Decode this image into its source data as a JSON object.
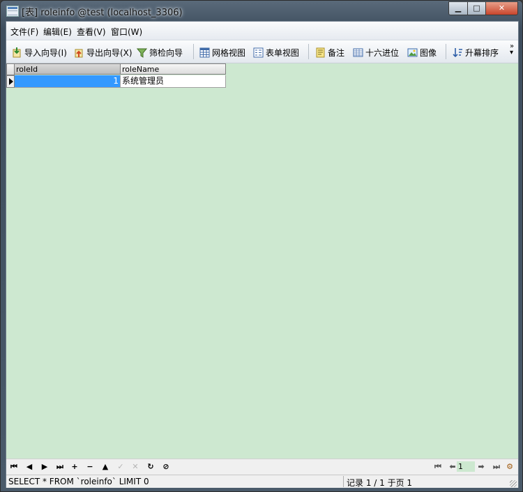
{
  "window": {
    "title": "[表] roleinfo @test (localhost_3306)",
    "minimize_label": "▁",
    "maximize_label": "□",
    "close_label": "✕"
  },
  "menu": [
    {
      "label": "文件(F)"
    },
    {
      "label": "编辑(E)"
    },
    {
      "label": "查看(V)"
    },
    {
      "label": "窗口(W)"
    }
  ],
  "toolbar": {
    "import_label": "导入向导(I)",
    "export_label": "导出向导(X)",
    "filter_label": "筛检向导",
    "grid_view_label": "网格视图",
    "form_view_label": "表单视图",
    "memo_label": "备注",
    "hex_label": "十六进位",
    "image_label": "图像",
    "sort_label": "升幕排序"
  },
  "grid": {
    "columns": [
      "roleId",
      "roleName"
    ],
    "rows": [
      [
        "1",
        "系统管理员"
      ]
    ]
  },
  "nav": {
    "first": "⏮",
    "prev": "◀",
    "next": "▶",
    "last": "⏭",
    "add": "+",
    "delete": "−",
    "apply": "▲",
    "commit": "✓",
    "cancel": "✕",
    "refresh": "↻",
    "stop": "⊘",
    "page_value": "1"
  },
  "status": {
    "sql": "SELECT * FROM `roleinfo` LIMIT 0",
    "record": "记录 1 / 1 于页 1"
  },
  "colors": {
    "grid_background": "#cde8d0",
    "selected_cell": "#3399ff"
  }
}
